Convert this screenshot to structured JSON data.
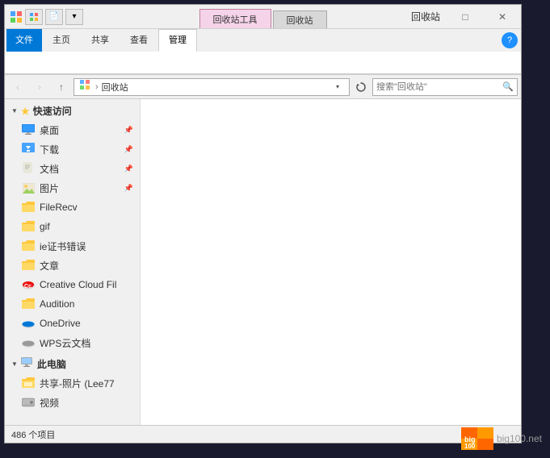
{
  "window": {
    "title": "回收站",
    "tabs": [
      {
        "label": "回收站工具",
        "active": true
      },
      {
        "label": "回收站",
        "active": false
      }
    ],
    "controls": {
      "minimize": "—",
      "maximize": "□",
      "close": "✕"
    }
  },
  "ribbon": {
    "tabs": [
      {
        "label": "文件",
        "type": "file"
      },
      {
        "label": "主页",
        "active": false
      },
      {
        "label": "共享",
        "active": false
      },
      {
        "label": "查看",
        "active": false
      },
      {
        "label": "管理",
        "active": true
      }
    ],
    "help_icon": "?"
  },
  "address_bar": {
    "back": "‹",
    "forward": "›",
    "up": "↑",
    "path_icon": "🗂",
    "path": "回收站",
    "refresh": "⟳",
    "search_placeholder": "搜索\"回收站\""
  },
  "sidebar": {
    "quick_access": {
      "label": "快速访问",
      "items": [
        {
          "label": "桌面",
          "icon": "desktop",
          "pinned": true
        },
        {
          "label": "下载",
          "icon": "download",
          "pinned": true
        },
        {
          "label": "文档",
          "icon": "doc",
          "pinned": true
        },
        {
          "label": "图片",
          "icon": "img",
          "pinned": true
        },
        {
          "label": "FileRecv",
          "icon": "folder",
          "pinned": false
        },
        {
          "label": "gif",
          "icon": "folder",
          "pinned": false
        },
        {
          "label": "ie证书错误",
          "icon": "folder",
          "pinned": false
        },
        {
          "label": "文章",
          "icon": "folder",
          "pinned": false
        }
      ]
    },
    "special_items": [
      {
        "label": "Creative Cloud Fil",
        "icon": "cc"
      },
      {
        "label": "Audition",
        "icon": "audition"
      },
      {
        "label": "OneDrive",
        "icon": "onedrive"
      },
      {
        "label": "WPS云文档",
        "icon": "wps"
      },
      {
        "label": "此电脑",
        "icon": "computer"
      }
    ],
    "computer_items": [
      {
        "label": "共享-照片 (Lee77",
        "icon": "share"
      },
      {
        "label": "视频",
        "icon": "hdd"
      }
    ]
  },
  "status_bar": {
    "count": "486 个项目"
  },
  "watermark": {
    "text": "big100.net"
  }
}
